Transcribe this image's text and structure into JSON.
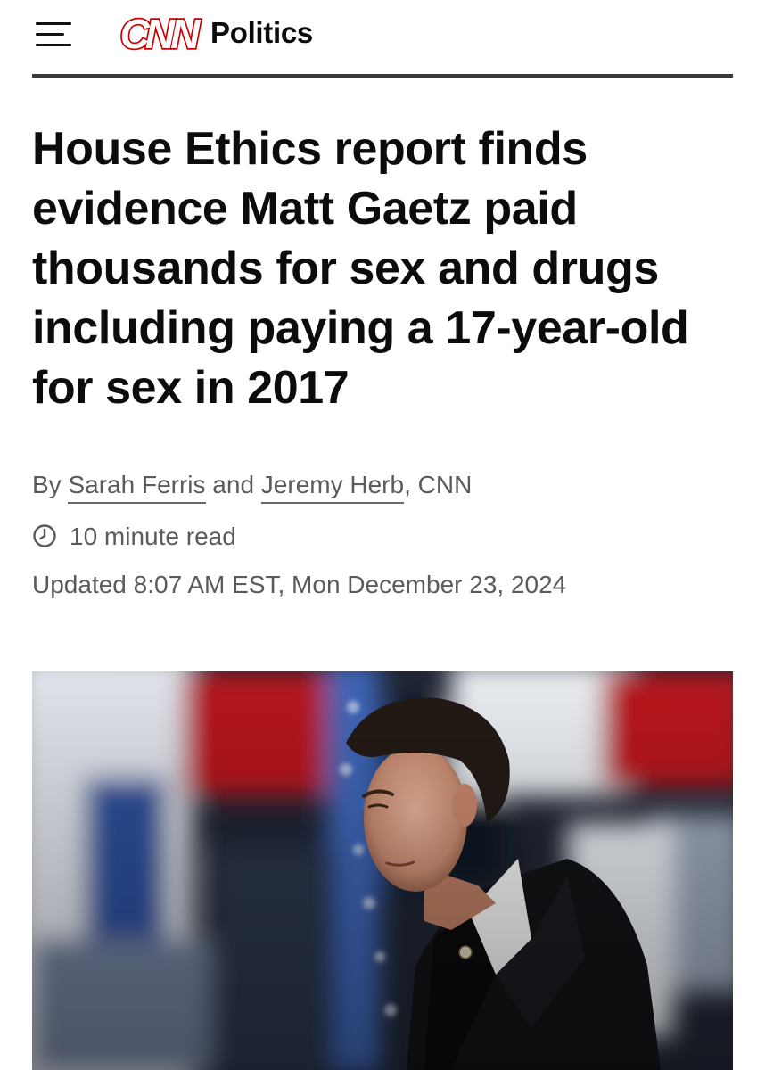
{
  "header": {
    "logo_text": "CNN",
    "section": "Politics"
  },
  "article": {
    "headline": "House Ethics report finds evidence Matt Gaetz paid thousands for sex and drugs including paying a 17-year-old for sex in 2017",
    "byline": {
      "prefix": "By",
      "author1": "Sarah Ferris",
      "joiner": "and",
      "author2": "Jeremy Herb",
      "suffix": ", CNN"
    },
    "read_time": "10 minute read",
    "updated": "Updated 8:07 AM EST, Mon December 23, 2024"
  },
  "colors": {
    "brand_red": "#cc0000",
    "text_primary": "#0c0c0c",
    "text_secondary": "#5b5b5b"
  },
  "icons": {
    "menu": "hamburger-menu-icon",
    "clock": "clock-icon"
  }
}
